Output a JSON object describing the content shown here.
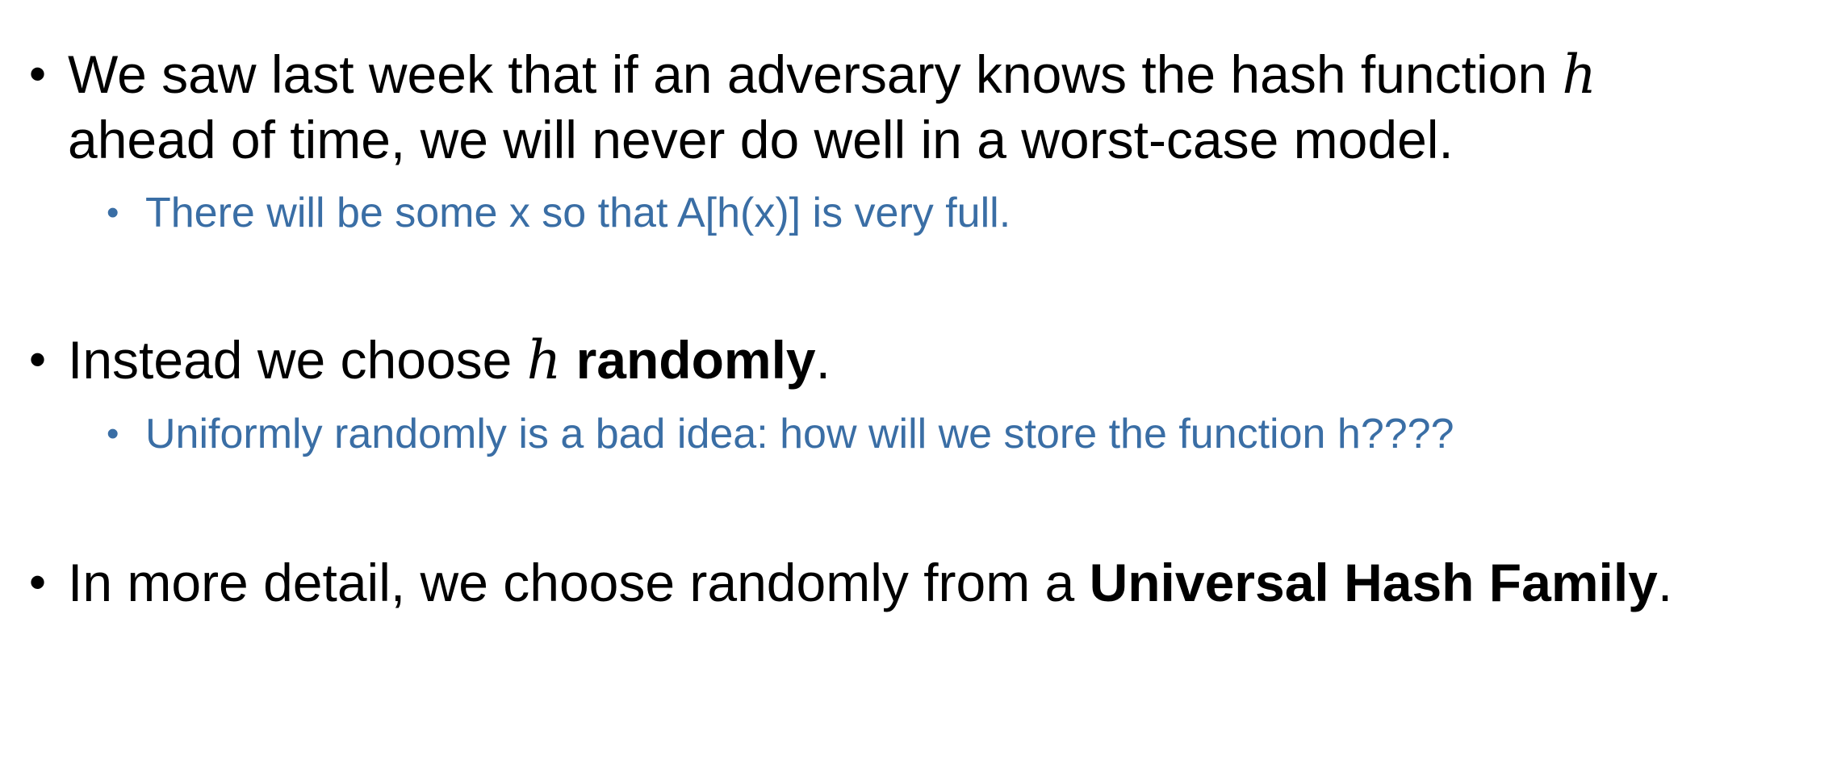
{
  "bullets": [
    {
      "line1_text": "We saw last week that if an adversary knows the hash function ",
      "line1_math": "h",
      "line2_text": "ahead of time, we will never do well in a worst-case model.",
      "sub": "There will be some x so that A[h(x)] is very full."
    },
    {
      "pre": "Instead we choose ",
      "math": "h",
      "mid": " ",
      "bold": "randomly",
      "post": ".",
      "sub": "Uniformly randomly is a bad idea: how will we store the function h????"
    },
    {
      "pre": "In more detail, we choose randomly from a ",
      "bold": "Universal Hash Family",
      "post": "."
    }
  ],
  "bullet_glyph": "•",
  "colors": {
    "primary_text": "#000000",
    "sub_text": "#3A6EA5"
  }
}
